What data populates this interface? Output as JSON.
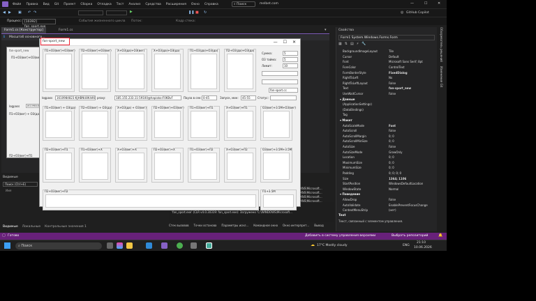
{
  "menu": [
    "Файл",
    "Правка",
    "Вид",
    "Git",
    "Проект",
    "Сборка",
    "Отладка",
    "Тест",
    "Анализ",
    "Средства",
    "Расширения",
    "Окно",
    "Справка"
  ],
  "search": {
    "label": "Поиск"
  },
  "solution_name": "melbet.com",
  "window_controls": {
    "min": "—",
    "max": "☐",
    "close": "✕"
  },
  "toolbar": {
    "copilot": "GitHub Copilot",
    "process_label": "Процесс:",
    "process_value": "[10392] fan_sport.exe",
    "lifecycle": "События жизненного цикла",
    "thread": "Поток:",
    "stack": "Кадр стека:"
  },
  "tabs": {
    "designer": "Form1.cs [Конструктор]",
    "code": "Form1.cs"
  },
  "info_bar": "Масштаб основного...",
  "form": {
    "title_text": "fan-sport_new",
    "groups_top": [
      "П1+О3(вег)+О3(вег)",
      "П2+О3(вег)+О3(вег)",
      "Х+О3(да)+О3(вег)",
      "Х+О3(да)+О3(да)",
      "П1+О3(да)+О3(да)",
      "П2+О3(да)+О3(да)"
    ],
    "groups_mid": [
      "П1+О3(вег) + О3(да)",
      "П2+О3(вег) + О3(да)",
      "Х+О3(да) + О3(вег)",
      "П2+О3(вег)+О3(вег)",
      "П1+О3(вег)+П1",
      "Х+О3(вег)+П1",
      "О3(вег)+3.5М+О3(вег)"
    ],
    "groups_bot": [
      "П2+О3(вег)+П1",
      "П1+О3(вег)+Х",
      "Х+О3(вег)+Х",
      "П2+О3(вег)+Х",
      "П1+О3(вег)+П2",
      "Х+О3(вег)+П2",
      "О3(вег)+3.5М+3.5М"
    ],
    "groups_last": [
      "П2+О3(вег)+П2",
      "П1+3.5М"
    ],
    "summa_label": "Сумма:",
    "summa_value": "5",
    "o3_label": "О3 тайма:",
    "o3_value": "5",
    "limit_label": "Лимит:",
    "limit_value": "10",
    "site_value": "fan-sport.cc",
    "login_label": "logpass",
    "login_value": "1610984823:KJHBNU8K446=",
    "proxy_label": "proxy:",
    "proxy_value": "185.155.233.11:59100@hapioko:F0KBvF",
    "pause_label": "Пауза в сек:",
    "pause_value": "0-45",
    "start_label": "Запуск, мин:",
    "start_value": "45-55",
    "status_label": "Статус:"
  },
  "left_panel": {
    "title_value": "fan-sport_new",
    "item1": "П1+О3(вег)+О3(вег)",
    "login_label": "logpass",
    "login_value": "1610984823",
    "item2": "П1+О3(вег) + О3(да)",
    "item3": "П2+О3(вег)+П1"
  },
  "watch": {
    "title": "Видимые",
    "search": "Поиск (Ctrl+E)",
    "name_col": "Имя"
  },
  "bottom_tabs": [
    "Видимые",
    "Локальные",
    "Контрольные значения 1"
  ],
  "output_lines": [
    "'fan_sport.exe' (CLR v4.0.30319: fan_sport.exe): Загружено 'C:\\WINDOWS\\Microsoft...",
    "'fan_sport.exe' (CLR v4.0.30319: fan_sport.exe): Загружено 'C:\\WINDOWS\\Microsoft...",
    "XNS\\Microsoft...",
    "XNS\\Microsoft...",
    "XNS\\Microsoft...",
    "XNS\\Microsoft..."
  ],
  "output_tabs": [
    "Стек вызовов",
    "Точки останова",
    "Параметры искл...",
    "Командное окно",
    "Окно интерпрет...",
    "Вывод"
  ],
  "properties": {
    "title": "Свойства",
    "object": "Form1 System.Windows.Forms.Form",
    "rows": [
      {
        "k": "BackgroundImageLayout",
        "v": "Tile"
      },
      {
        "k": "Cursor",
        "v": "Default"
      },
      {
        "k": "Font",
        "v": "Microsoft Sans Serif; 8pt"
      },
      {
        "k": "ForeColor",
        "v": "ControlText"
      },
      {
        "k": "FormBorderStyle",
        "v": "FixedDialog",
        "bold": true
      },
      {
        "k": "RightToLeft",
        "v": "No"
      },
      {
        "k": "RightToLeftLayout",
        "v": "False"
      },
      {
        "k": "Text",
        "v": "fan-sport_new",
        "bold": true
      },
      {
        "k": "UseWaitCursor",
        "v": "False"
      },
      {
        "cat": "Данные"
      },
      {
        "k": "(ApplicationSettings)",
        "v": ""
      },
      {
        "k": "(DataBindings)",
        "v": ""
      },
      {
        "k": "Tag",
        "v": ""
      },
      {
        "cat": "Макет"
      },
      {
        "k": "AutoScaleMode",
        "v": "Font",
        "bold": true
      },
      {
        "k": "AutoScroll",
        "v": "False"
      },
      {
        "k": "AutoScrollMargin",
        "v": "0; 0"
      },
      {
        "k": "AutoScrollMinSize",
        "v": "0; 0"
      },
      {
        "k": "AutoSize",
        "v": "False"
      },
      {
        "k": "AutoSizeMode",
        "v": "GrowOnly"
      },
      {
        "k": "Location",
        "v": "0; 0"
      },
      {
        "k": "MaximumSize",
        "v": "0; 0"
      },
      {
        "k": "MinimumSize",
        "v": "0; 0"
      },
      {
        "k": "Padding",
        "v": "0; 0; 0; 0"
      },
      {
        "k": "Size",
        "v": "1364; 1106",
        "bold": true
      },
      {
        "k": "StartPosition",
        "v": "WindowsDefaultLocation"
      },
      {
        "k": "WindowState",
        "v": "Normal"
      },
      {
        "cat": "Поведение"
      },
      {
        "k": "AllowDrop",
        "v": "False"
      },
      {
        "k": "AutoValidate",
        "v": "EnablePreventFocusChange"
      },
      {
        "k": "ContextMenuStrip",
        "v": "(нет)"
      }
    ],
    "desc_title": "Text",
    "desc_text": "Текст, связанный с элементом управления."
  },
  "right_rail": [
    "Обозреватель решений",
    "Изменения Git"
  ],
  "status_bar": {
    "left": "Готово",
    "add_source": "Добавить в систему управления версиями",
    "repo": "Выбрать репозиторий"
  },
  "taskbar": {
    "search": "Поиск",
    "weather": "17°C  Mostly cloudy",
    "lang": "ENG",
    "time": "21:10",
    "date": "10.06.2026"
  },
  "colors": {
    "vs_bg": "#1f1f1f",
    "vs_purple": "#68217a",
    "form_bg": "#f0f0f0"
  }
}
